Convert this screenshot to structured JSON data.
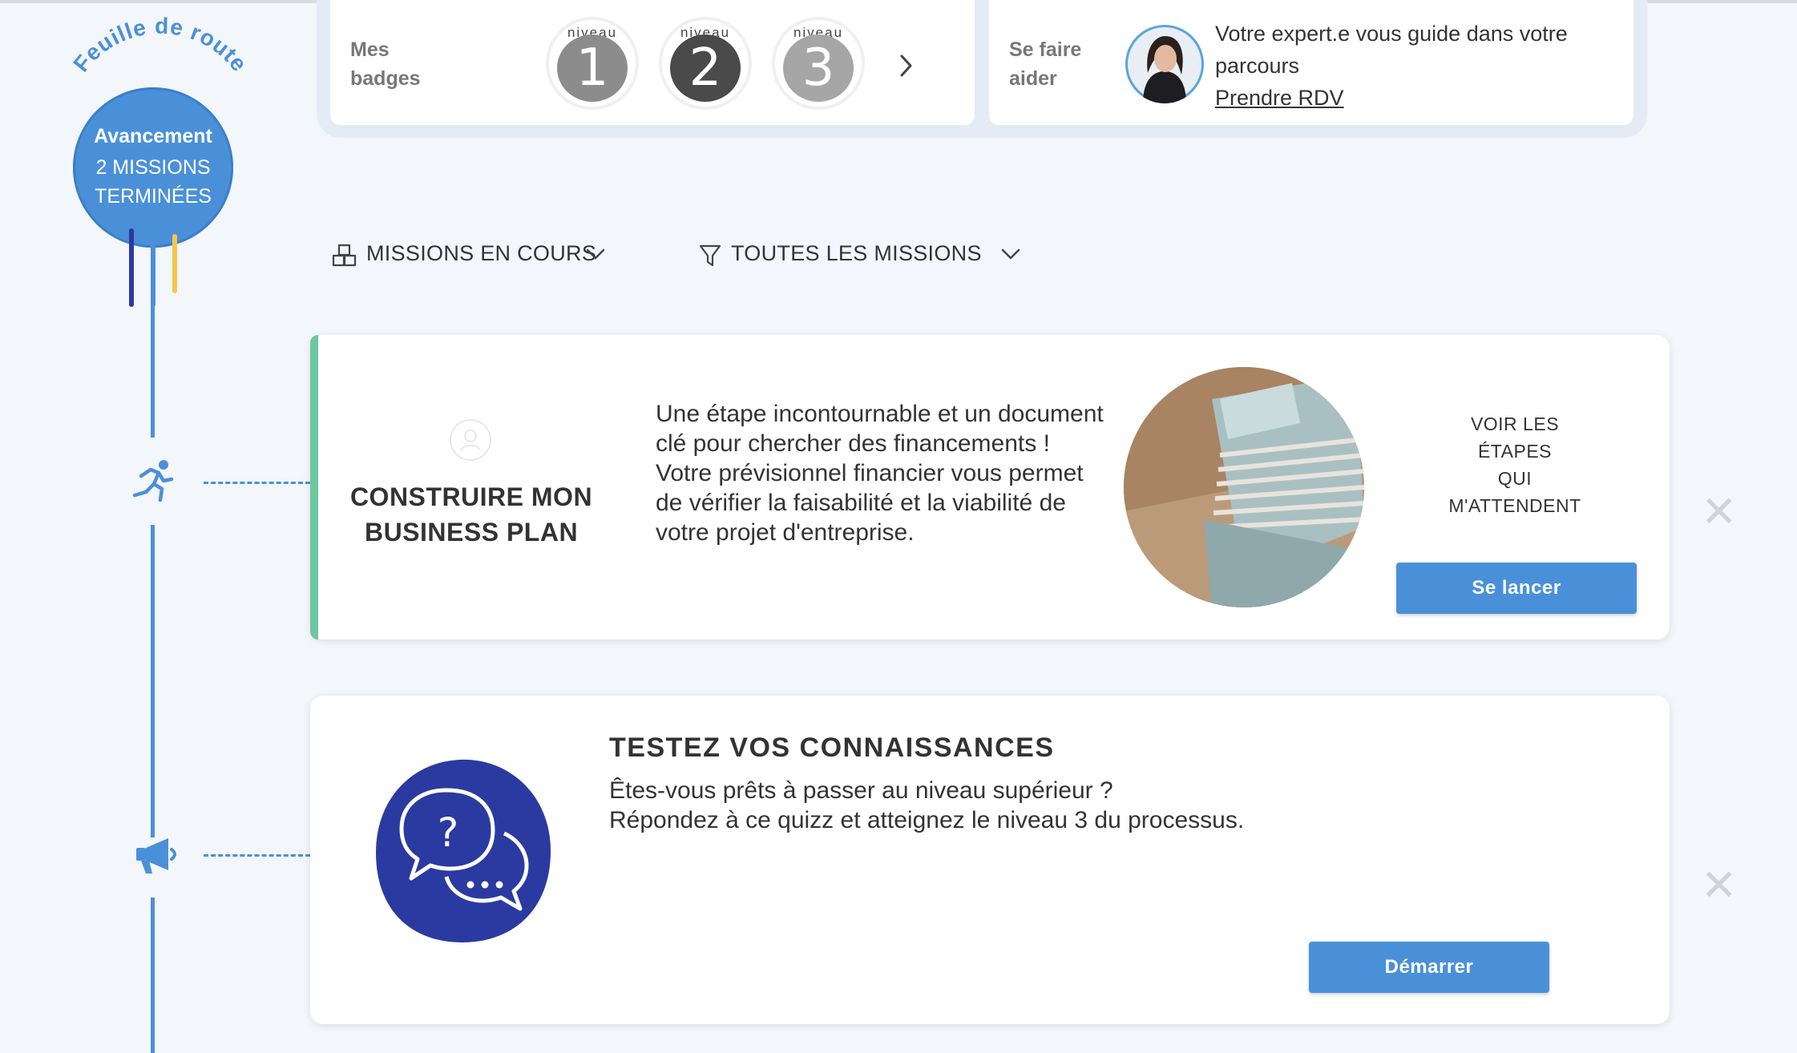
{
  "roadmap": {
    "arc_title": "Feuille de route",
    "progress_title": "Avancement",
    "progress_line1": "2 MISSIONS",
    "progress_line2": "TERMINÉES"
  },
  "badges": {
    "label_line1": "Mes",
    "label_line2": "badges",
    "items": [
      {
        "caption": "niveau",
        "number": "1",
        "color": "#8c8c8c"
      },
      {
        "caption": "niveau",
        "number": "2",
        "color": "#4a4a4a"
      },
      {
        "caption": "niveau",
        "number": "3",
        "color": "#a6a6a6"
      }
    ],
    "next_icon": "chevron-right-icon"
  },
  "help": {
    "label_line1": "Se faire",
    "label_line2": "aider",
    "text": "Votre expert.e vous guide dans votre parcours",
    "link": "Prendre RDV"
  },
  "filters": {
    "current": "MISSIONS EN COURS",
    "all": "TOUTES LES MISSIONS"
  },
  "missions": [
    {
      "title_line1": "CONSTRUIRE MON",
      "title_line2": "BUSINESS PLAN",
      "description": "Une étape incontournable et un document clé pour chercher des financements ! Votre prévisionnel financier vous permet de vérifier la faisabilité et la viabilité de votre projet d'entreprise.",
      "steps_line1": "VOIR LES",
      "steps_line2": "ÉTAPES",
      "steps_line3": "QUI",
      "steps_line4": "M'ATTENDENT",
      "button": "Se lancer",
      "accent_color": "#6ec6a0",
      "timeline_icon": "running-person-icon"
    },
    {
      "title": "TESTEZ VOS CONNAISSANCES",
      "description_line1": "Êtes-vous prêts à passer au niveau supérieur ?",
      "description_line2": "Répondez à ce quizz et atteignez le niveau 3 du processus.",
      "button": "Démarrer",
      "quiz_icon_color": "#2b3aa0",
      "timeline_icon": "megaphone-icon"
    }
  ],
  "colors": {
    "primary": "#4a90d9",
    "background": "#f3f6fb",
    "navy": "#2b3aa0",
    "yellow": "#f2c94c"
  }
}
